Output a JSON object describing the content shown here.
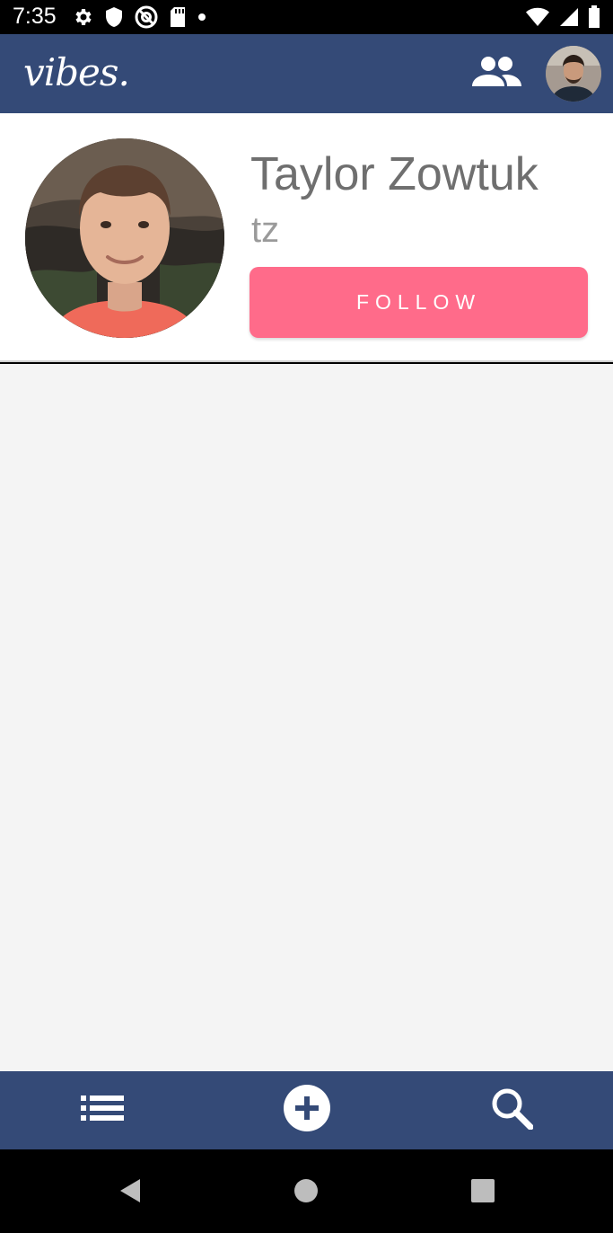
{
  "status_bar": {
    "time": "7:35",
    "icons_left": [
      "gear-icon",
      "shield-icon",
      "at-sign-icon",
      "sd-card-icon",
      "dot-icon"
    ],
    "icons_right": [
      "wifi-icon",
      "signal-icon",
      "battery-icon"
    ]
  },
  "app_bar": {
    "logo": "vibes.",
    "background_color": "#344a77"
  },
  "profile": {
    "name": "Taylor Zowtuk",
    "username": "tz",
    "follow_label": "FOLLOW",
    "follow_color": "#ff6b8a"
  },
  "bottom_nav": {
    "items": [
      "list-icon",
      "add-circle-icon",
      "search-icon"
    ]
  },
  "system_nav": {
    "items": [
      "back-icon",
      "home-icon",
      "recents-icon"
    ]
  }
}
